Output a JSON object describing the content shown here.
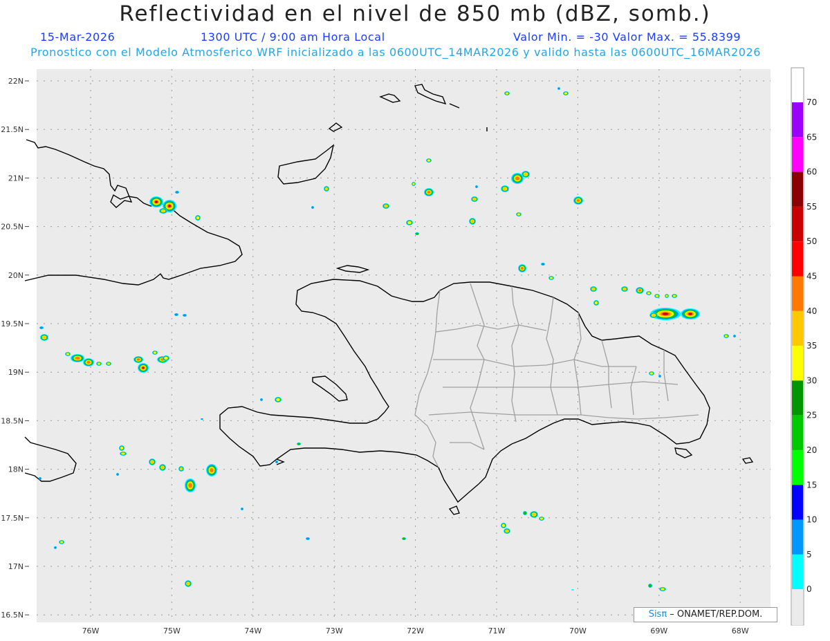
{
  "header": {
    "title": "Reflectividad en el nivel de 850 mb (dBZ, somb.)",
    "date": "15-Mar-2026",
    "time": "1300 UTC / 9:00 am Hora Local",
    "minmax": "Valor Min. = -30  Valor Max. = 55.8399",
    "model_info": "Pronostico con el Modelo Atmosferico WRF inicializado a las 0600UTC_14MAR2026 y valido hasta las  0600UTC_16MAR2026"
  },
  "map": {
    "lat_labels": [
      "22N",
      "21.5N",
      "21N",
      "20.5N",
      "20N",
      "19.5N",
      "19N",
      "18.5N",
      "18N",
      "17.5N",
      "17N",
      "16.5N"
    ],
    "lon_labels": [
      "76W",
      "75W",
      "74W",
      "73W",
      "72W",
      "71W",
      "70W",
      "69W",
      "68W"
    ],
    "background_color": "#ebebeb",
    "coast_color": "#000000",
    "province_color": "#a0a0a0"
  },
  "colorbar": {
    "labels": [
      "70",
      "65",
      "60",
      "55",
      "50",
      "45",
      "40",
      "35",
      "30",
      "25",
      "20",
      "15",
      "10",
      "5",
      "0"
    ],
    "colors": [
      "#9b00ff",
      "#ff00ff",
      "#8b0000",
      "#c80000",
      "#ff0000",
      "#ff7800",
      "#ffc800",
      "#ffff00",
      "#009600",
      "#00c800",
      "#00ff00",
      "#0000ff",
      "#0096ff",
      "#00ffff",
      "#ebebeb"
    ]
  },
  "credit": {
    "logo": "Sisπ",
    "text": " – ONAMET/REP.DOM."
  }
}
